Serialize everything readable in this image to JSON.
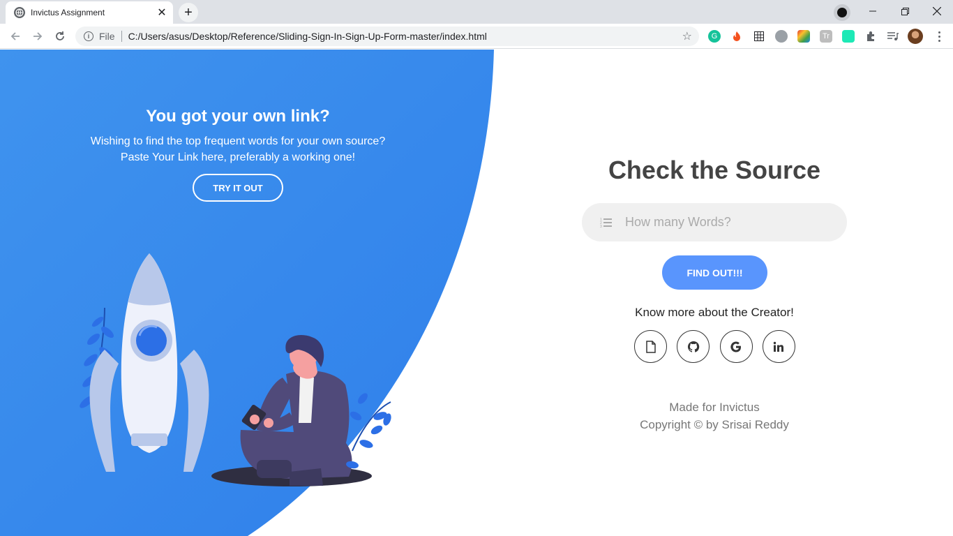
{
  "browser": {
    "tab_title": "Invictus Assignment",
    "url_scheme_label": "File",
    "url": "C:/Users/asus/Desktop/Reference/Sliding-Sign-In-Sign-Up-Form-master/index.html"
  },
  "left_panel": {
    "title": "You got your own link?",
    "desc_line1": "Wishing to find the top frequent words for your own source?",
    "desc_line2": "Paste Your Link here, preferably a working one!",
    "button_label": "TRY IT OUT"
  },
  "right_panel": {
    "title": "Check the Source",
    "input_placeholder": "How many Words?",
    "button_label": "FIND OUT!!!",
    "know_more": "Know more about the Creator!",
    "socials": [
      "document-icon",
      "github-icon",
      "google-icon",
      "linkedin-icon"
    ],
    "footer_line1": "Made for Invictus",
    "footer_line2": "Copyright © by Srisai Reddy"
  },
  "colors": {
    "accent_blue": "#4481eb",
    "accent_blue_light": "#04befe",
    "button_blue": "#5995fd"
  }
}
